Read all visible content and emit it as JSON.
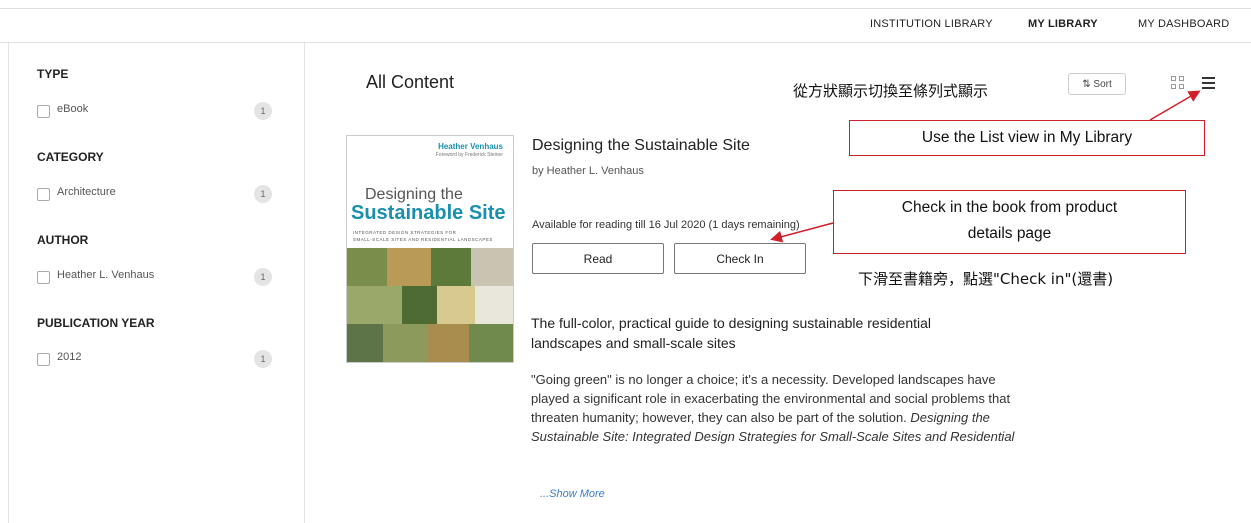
{
  "topnav": {
    "institution_library": "INSTITUTION LIBRARY",
    "my_library": "MY LIBRARY",
    "my_dashboard": "MY DASHBOARD"
  },
  "sidebar": {
    "facets": [
      {
        "title": "TYPE",
        "items": [
          {
            "label": "eBook",
            "count": "1"
          }
        ]
      },
      {
        "title": "CATEGORY",
        "items": [
          {
            "label": "Architecture",
            "count": "1"
          }
        ]
      },
      {
        "title": "AUTHOR",
        "items": [
          {
            "label": "Heather L. Venhaus",
            "count": "1"
          }
        ]
      },
      {
        "title": "PUBLICATION YEAR",
        "items": [
          {
            "label": "2012",
            "count": "1"
          }
        ]
      }
    ]
  },
  "main": {
    "title": "All Content",
    "sort_label": "⇅ Sort",
    "view_icons": [
      "grid-view-icon",
      "list-view-icon"
    ]
  },
  "book": {
    "cover": {
      "author": "Heather Venhaus",
      "foreword": "Foreword by Frederick Steiner",
      "title_line1": "Designing the",
      "title_line2": "Sustainable Site",
      "subtitle_line1": "INTEGRATED DESIGN STRATEGIES FOR",
      "subtitle_line2": "SMALL-SCALE SITES AND RESIDENTIAL LANDSCAPES"
    },
    "title": "Designing the Sustainable Site",
    "byline": "by Heather L. Venhaus",
    "availability": "Available for reading till 16 Jul 2020 (1 days remaining)",
    "read_label": "Read",
    "checkin_label": "Check In",
    "headline": "The full-color, practical guide to designing sustainable residential landscapes and small-scale sites",
    "description_plain": "\"Going green\" is no longer a choice; it's a necessity. Developed landscapes have played a significant role in exacerbating the environmental and social problems that threaten humanity; however, they can also be part of the solution. ",
    "description_italic": "Designing the Sustainable Site: Integrated Design Strategies for Small-Scale Sites and Residential",
    "show_more": "...Show More"
  },
  "annotations": {
    "list_view_zh": "從方狀顯示切換至條列式顯示",
    "list_view_box": "Use the List view in My Library",
    "checkin_box_line1": "Check in the book from product",
    "checkin_box_line2": "details page",
    "checkin_zh": "下滑至書籍旁，點選\"Check in\"(還書)",
    "color": "#d0202a"
  }
}
